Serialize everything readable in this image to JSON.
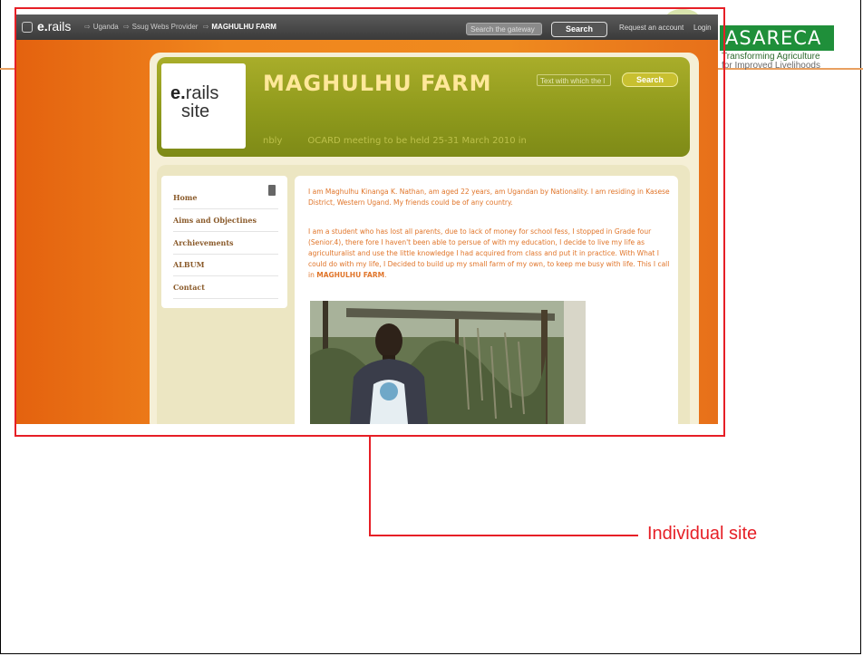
{
  "slide": {
    "logo_text": "ASARECA",
    "logo_tagline_1": "Transforming Agriculture",
    "logo_tagline_2": "for Improved Livelihoods",
    "callout_label": "Individual site",
    "highlight_color": "#e61f26"
  },
  "browser": {
    "brand_bold": "e.",
    "brand_rest": "rails",
    "breadcrumbs": [
      "Uganda",
      "Ssug Webs Provider",
      "MAGHULHU FARM"
    ],
    "search_placeholder": "Search the gateway",
    "search_button": "Search",
    "request_account": "Request an account",
    "login": "Login"
  },
  "site": {
    "logo_bold": "e.",
    "logo_rest": "rails",
    "logo_site": "site",
    "title": "MAGHULHU FARM",
    "header_search_placeholder": "Text with which the l",
    "header_search_button": "Search",
    "ticker_left": "nbly",
    "ticker_text": "OCARD meeting to be held 25-31 March 2010 in",
    "colors": {
      "header_green": "#8f9a1c",
      "title_yellow": "#ffe89a",
      "text_orange": "#e0752a"
    }
  },
  "menu": {
    "items": [
      "Home",
      "Aims and Objectines",
      "Archievements",
      "ALBUM",
      "Contact"
    ]
  },
  "body": {
    "para1": "I am Maghulhu Kinanga K. Nathan, am aged 22 years, am Ugandan by Nationality. I am residing in Kasese District, Western Ugand. My friends could be of any country.",
    "para2_text": "I am a student who has lost all parents, due to lack of money for school fess, I stopped in Grade four (Senior.4), there fore I haven't been able to persue of with my education, I decide to live my life as agriculturalist and use the little knowledge I had acquired from class and put it in practice. With What I could do with my life, I Decided to build up my small farm of my own, to keep me busy with life. This I call in ",
    "para2_bold": "MAGHULHU FARM",
    "para2_end": "."
  }
}
